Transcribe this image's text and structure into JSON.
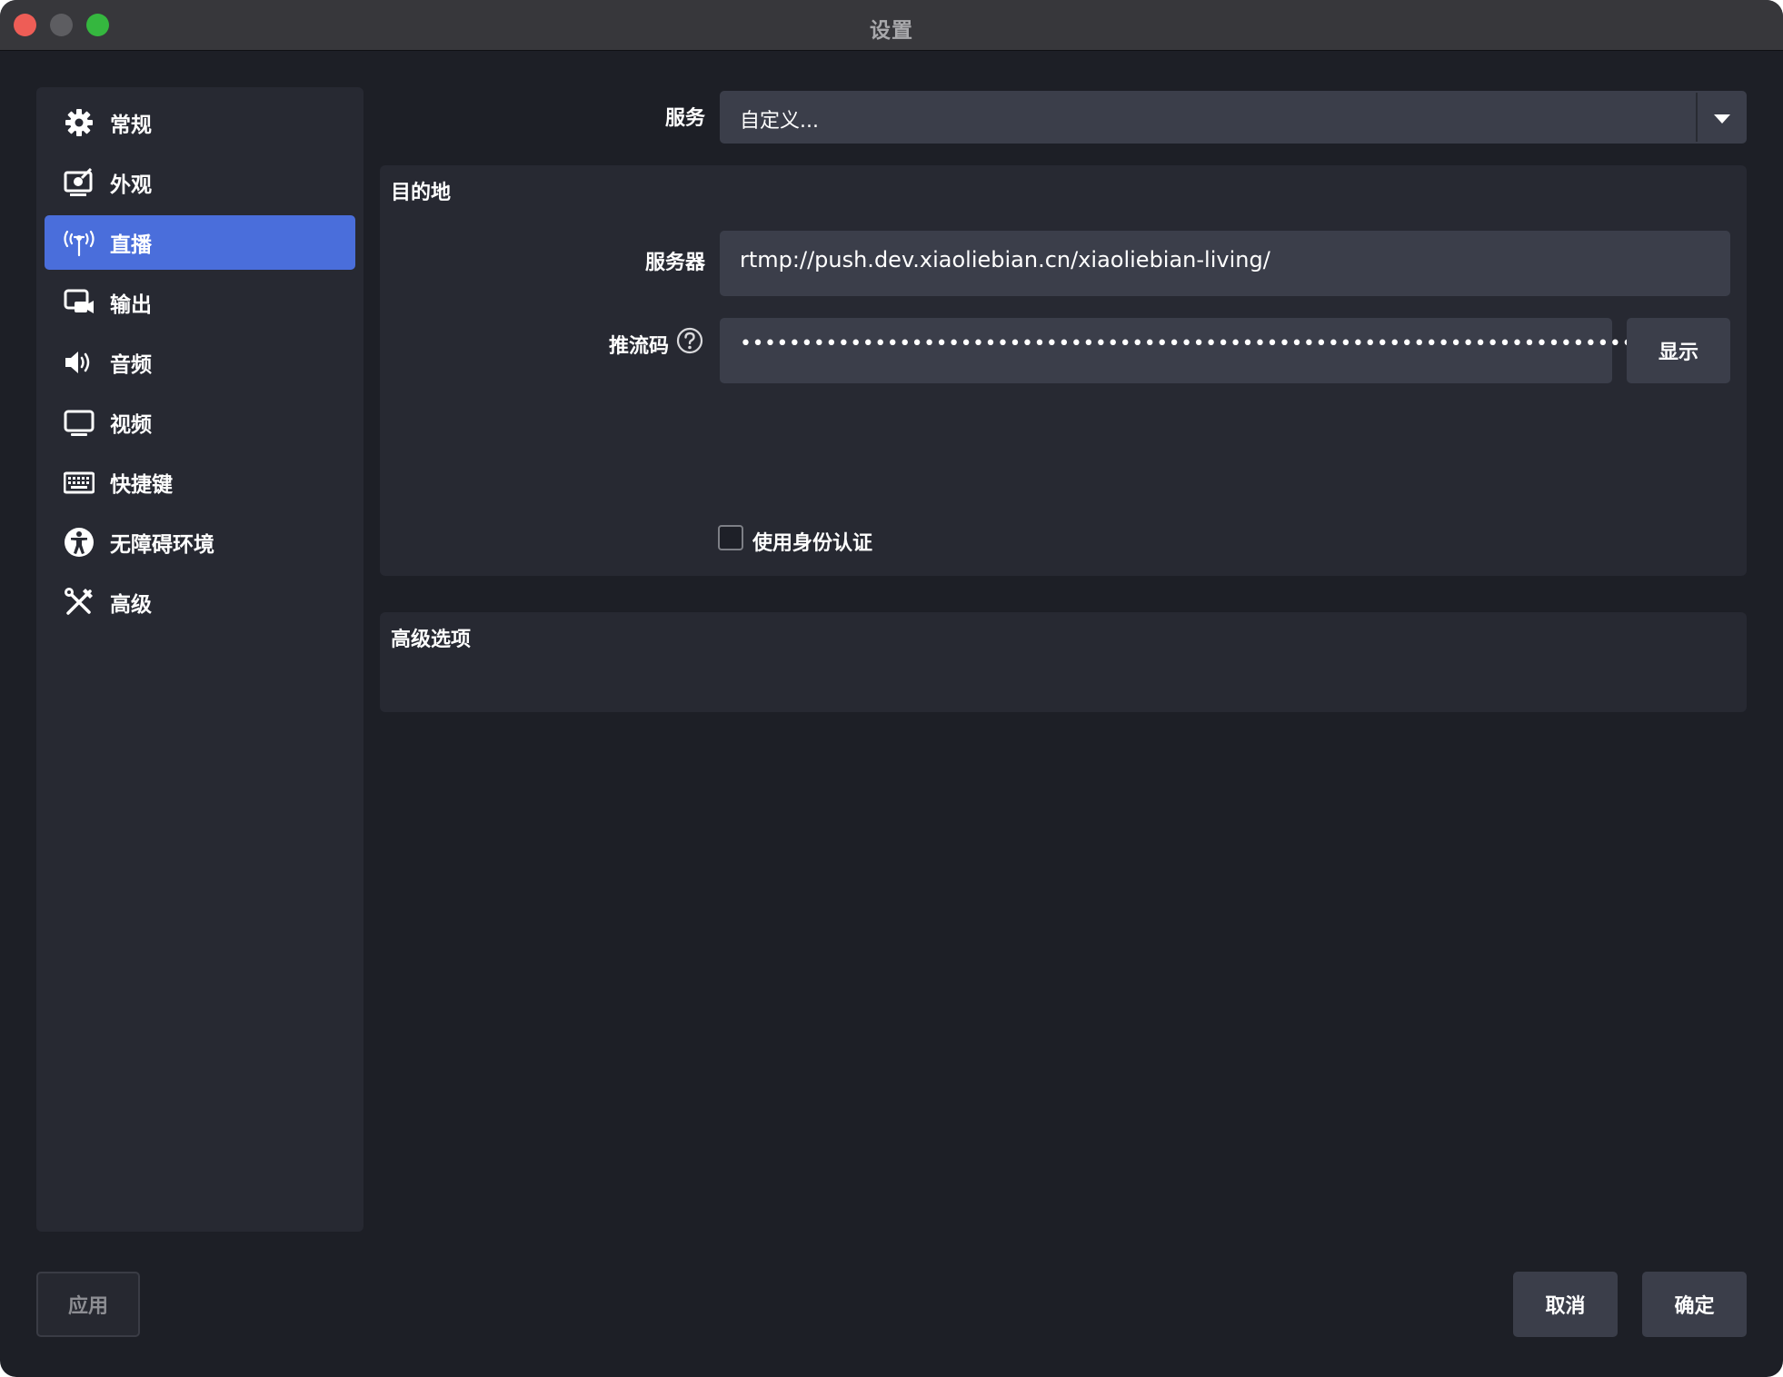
{
  "window": {
    "title": "设置"
  },
  "sidebar": {
    "items": [
      {
        "label": "常规",
        "icon": "gear-icon"
      },
      {
        "label": "外观",
        "icon": "appearance-icon"
      },
      {
        "label": "直播",
        "icon": "antenna-icon",
        "active": true
      },
      {
        "label": "输出",
        "icon": "output-icon"
      },
      {
        "label": "音频",
        "icon": "speaker-icon"
      },
      {
        "label": "视频",
        "icon": "monitor-icon"
      },
      {
        "label": "快捷键",
        "icon": "keyboard-icon"
      },
      {
        "label": "无障碍环境",
        "icon": "accessibility-icon"
      },
      {
        "label": "高级",
        "icon": "tools-icon"
      }
    ]
  },
  "stream": {
    "service_label": "服务",
    "service_value": "自定义...",
    "destination": {
      "title": "目的地",
      "server_label": "服务器",
      "server_value": "rtmp://push.dev.xiaoliebian.cn/xiaoliebian-living/",
      "key_label": "推流码",
      "key_value": "••••••••••••••••••••••••••••••••••••••••••••••••••••••••••••••••••••••••••",
      "show_button": "显示",
      "auth_label": "使用身份认证",
      "auth_checked": false
    },
    "advanced": {
      "title": "高级选项"
    }
  },
  "footer": {
    "apply": "应用",
    "cancel": "取消",
    "ok": "确定"
  },
  "colors": {
    "window_bg": "#1d1f26",
    "panel_bg": "#272932",
    "input_bg": "#3b3e4a",
    "accent": "#4a6edb",
    "close": "#ee5d56",
    "minimize": "#5d5d61",
    "maximize": "#35b73f"
  }
}
